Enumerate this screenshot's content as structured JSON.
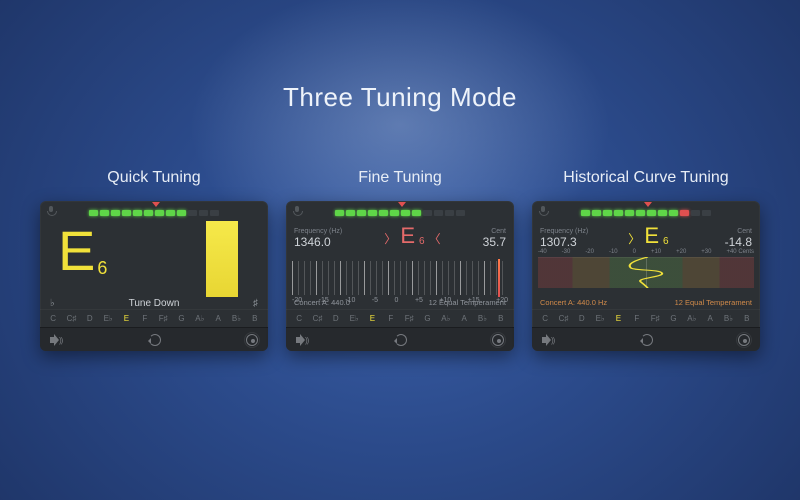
{
  "title": "Three Tuning Mode",
  "cards": {
    "quick": {
      "title": "Quick Tuning",
      "note": "E",
      "octave": "6",
      "hint": "Tune Down",
      "flat": "♭",
      "sharp": "♯"
    },
    "fine": {
      "title": "Fine Tuning",
      "freq_label": "Frequency (Hz)",
      "freq": "1346.0",
      "cent_label": "Cent",
      "cent": "35.7",
      "note": "E",
      "octave": "6",
      "concert_a": "Concert A: 440.0",
      "temperament": "12 Equal Temperament",
      "scale_ticks": [
        "-20",
        "-15",
        "-10",
        "-5",
        "0",
        "+5",
        "+10",
        "+15",
        "+20"
      ]
    },
    "hist": {
      "title": "Historical Curve Tuning",
      "freq_label": "Frequency (Hz)",
      "freq": "1307.3",
      "cent_label": "Cent",
      "cent": "-14.8",
      "note": "E",
      "octave": "6",
      "concert_a": "Concert A: 440.0  Hz",
      "temperament": "12 Equal Temperament",
      "ticks": [
        "-40",
        "-30",
        "-20",
        "-10",
        "0",
        "+10",
        "+20",
        "+30",
        "+40 Cents"
      ]
    }
  },
  "note_names": [
    "C",
    "C♯",
    "D",
    "E♭",
    "E",
    "F",
    "F♯",
    "G",
    "A♭",
    "A",
    "B♭",
    "B"
  ],
  "highlight_note_index": 4
}
